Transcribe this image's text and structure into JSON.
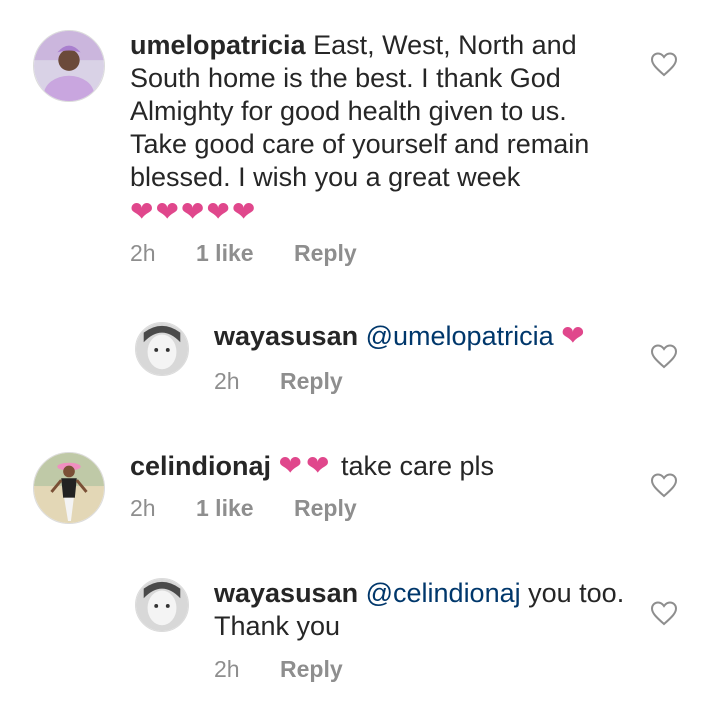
{
  "comments": [
    {
      "username": "umelopatricia",
      "text": "East, West, North and South home is the best. I thank God Almighty for good health given to us. Take good care of yourself and remain blessed. I wish you a great week",
      "emoji": "❤❤❤❤❤",
      "time": "2h",
      "likes": "1 like",
      "reply_label": "Reply"
    },
    {
      "username": "wayasusan",
      "mention": "@umelopatricia",
      "emoji": "❤",
      "time": "2h",
      "reply_label": "Reply"
    },
    {
      "username": "celindionaj",
      "emoji": "❤❤",
      "text": "take care pls",
      "time": "2h",
      "likes": "1 like",
      "reply_label": "Reply"
    },
    {
      "username": "wayasusan",
      "mention": "@celindionaj",
      "text": "you too. Thank you",
      "time": "2h",
      "reply_label": "Reply"
    }
  ],
  "icons": {
    "like": "heart-outline-icon"
  },
  "colors": {
    "text": "#262626",
    "meta": "#8e8e8e",
    "mention": "#00376b",
    "emoji_heart": "#e0478c"
  }
}
